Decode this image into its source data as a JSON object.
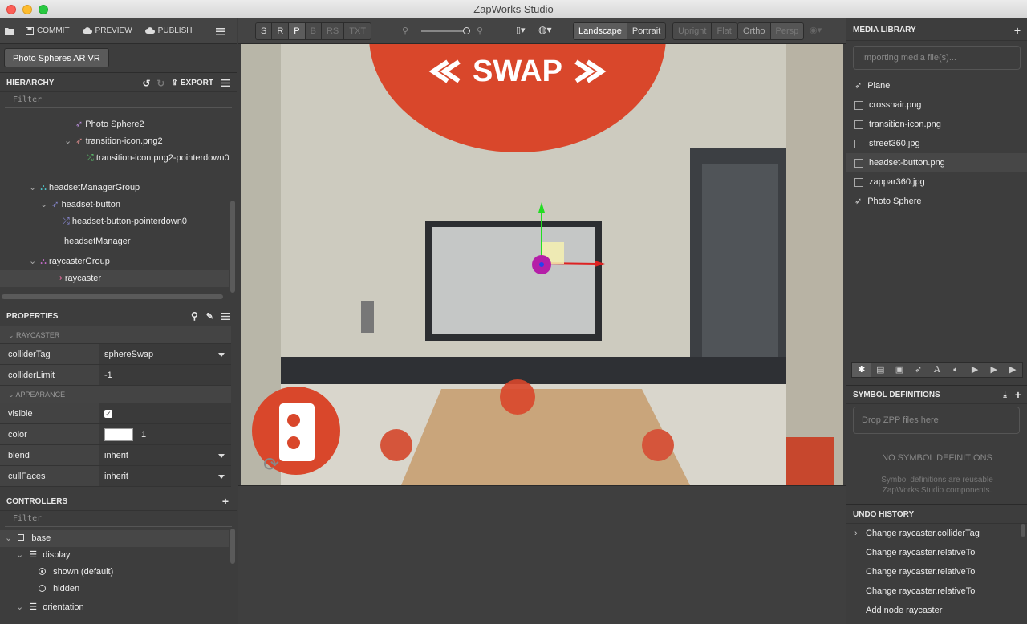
{
  "window": {
    "title": "ZapWorks Studio"
  },
  "toolbar": {
    "commit": "COMMIT",
    "preview": "PREVIEW",
    "publish": "PUBLISH"
  },
  "project": {
    "name": "Photo Spheres AR VR"
  },
  "hierarchy": {
    "title": "HIERARCHY",
    "export": "EXPORT",
    "filter_placeholder": "Filter",
    "items": [
      {
        "label": "Photo Sphere2"
      },
      {
        "label": "transition-icon.png2"
      },
      {
        "label": "transition-icon.png2-pointerdown0"
      },
      {
        "label": "headsetManagerGroup"
      },
      {
        "label": "headset-button"
      },
      {
        "label": "headset-button-pointerdown0"
      },
      {
        "label": "headsetManager"
      },
      {
        "label": "raycasterGroup"
      },
      {
        "label": "raycaster"
      }
    ]
  },
  "properties": {
    "title": "PROPERTIES",
    "section_raycaster": "RAYCASTER",
    "section_appearance": "APPEARANCE",
    "rows": {
      "colliderTag": {
        "name": "colliderTag",
        "value": "sphereSwap"
      },
      "colliderLimit": {
        "name": "colliderLimit",
        "value": "-1"
      },
      "visible": {
        "name": "visible"
      },
      "color": {
        "name": "color",
        "alpha": "1"
      },
      "blend": {
        "name": "blend",
        "value": "inherit"
      },
      "cullFaces": {
        "name": "cullFaces",
        "value": "inherit"
      }
    }
  },
  "controllers": {
    "title": "CONTROLLERS",
    "filter_placeholder": "Filter",
    "items": [
      {
        "label": "base"
      },
      {
        "label": "display"
      },
      {
        "label": "shown (default)"
      },
      {
        "label": "hidden"
      },
      {
        "label": "orientation"
      }
    ]
  },
  "viewport_toolbar": {
    "modes": [
      "S",
      "R",
      "P",
      "B",
      "RS",
      "TXT"
    ],
    "orientation": [
      "Landscape",
      "Portrait"
    ],
    "view": [
      "Upright",
      "Flat"
    ],
    "projection": [
      "Ortho",
      "Persp"
    ]
  },
  "viewport": {
    "swap_text": "SWAP"
  },
  "media_library": {
    "title": "MEDIA LIBRARY",
    "status": "Importing media file(s)...",
    "items": [
      {
        "label": "Plane",
        "icon": "rocket-icon"
      },
      {
        "label": "crosshair.png",
        "icon": "image-icon"
      },
      {
        "label": "transition-icon.png",
        "icon": "image-icon"
      },
      {
        "label": "street360.jpg",
        "icon": "image-icon"
      },
      {
        "label": "headset-button.png",
        "icon": "image-icon"
      },
      {
        "label": "zappar360.jpg",
        "icon": "image-icon"
      },
      {
        "label": "Photo Sphere",
        "icon": "rocket-icon"
      }
    ]
  },
  "symbols": {
    "title": "SYMBOL DEFINITIONS",
    "drop_hint": "Drop ZPP files here",
    "empty_title": "NO SYMBOL DEFINITIONS",
    "empty_desc": "Symbol definitions are reusable ZapWorks Studio components."
  },
  "undo": {
    "title": "UNDO HISTORY",
    "items": [
      "Change raycaster.colliderTag",
      "Change raycaster.relativeTo",
      "Change raycaster.relativeTo",
      "Change raycaster.relativeTo",
      "Add node raycaster"
    ]
  },
  "colors": {
    "accent_orange": "#d9472b",
    "panel_bg": "#3d3d3d"
  }
}
